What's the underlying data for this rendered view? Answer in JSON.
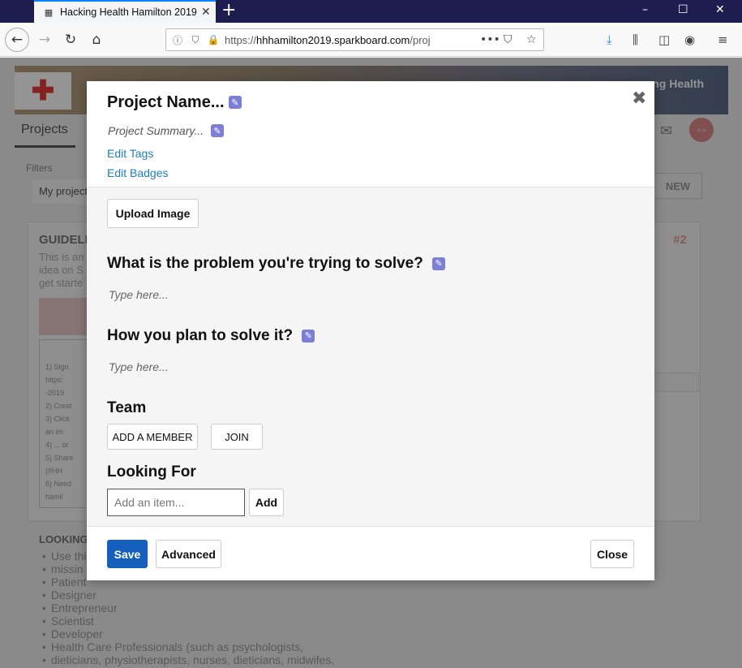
{
  "browser": {
    "tab_title": "Hacking Health Hamilton 2019",
    "tab_close": "✕",
    "new_tab": "+",
    "url_scheme": "https://",
    "url_host": "hhhamilton2019.sparkboard.com",
    "url_path": "/proj",
    "page_actions": "•••",
    "window_controls": [
      "–",
      "☐",
      "✕"
    ]
  },
  "background": {
    "banner_right_text": "ng Health",
    "tab_projects": "Projects",
    "filters_label": "Filters",
    "my_projects": "My project",
    "new_button": "NEW",
    "card_title": "GUIDELI",
    "card_rank": "#2",
    "card_lines": [
      "This is an",
      "idea on S",
      "get starte"
    ],
    "steps": [
      "1)   Sign",
      "      https:",
      "      -2019",
      "2)   Creat",
      "3)   Click",
      "      an im",
      "4)   ... or",
      "5)   Share",
      "      (#HH",
      "6)   Need",
      "      hamil"
    ],
    "looking_title": "LOOKING",
    "roles": [
      "Use thi",
      "missin",
      "Patient",
      "Designer",
      "Entrepreneur",
      "Scientist",
      "Developer",
      "Health Care Professionals (such as psychologists,",
      "dieticians, physiotherapists, nurses, dieticians, midwifes,"
    ]
  },
  "modal": {
    "project_name": "Project Name...",
    "project_summary": "Project Summary...",
    "edit_tags": "Edit Tags",
    "edit_badges": "Edit Badges",
    "upload_image": "Upload Image",
    "q_problem": "What is the problem you're trying to solve?",
    "q_problem_placeholder": "Type here...",
    "q_solution": "How you plan to solve it?",
    "q_solution_placeholder": "Type here...",
    "team_title": "Team",
    "add_member": "ADD A MEMBER",
    "join": "JOIN",
    "looking_for_title": "Looking For",
    "looking_for_input_placeholder": "Add an item...",
    "add": "Add",
    "save": "Save",
    "advanced": "Advanced",
    "close": "Close",
    "close_x": "✖"
  },
  "colors": {
    "primary": "#1560bd",
    "link": "#1f7fba",
    "pencil": "#7b7fd6"
  }
}
